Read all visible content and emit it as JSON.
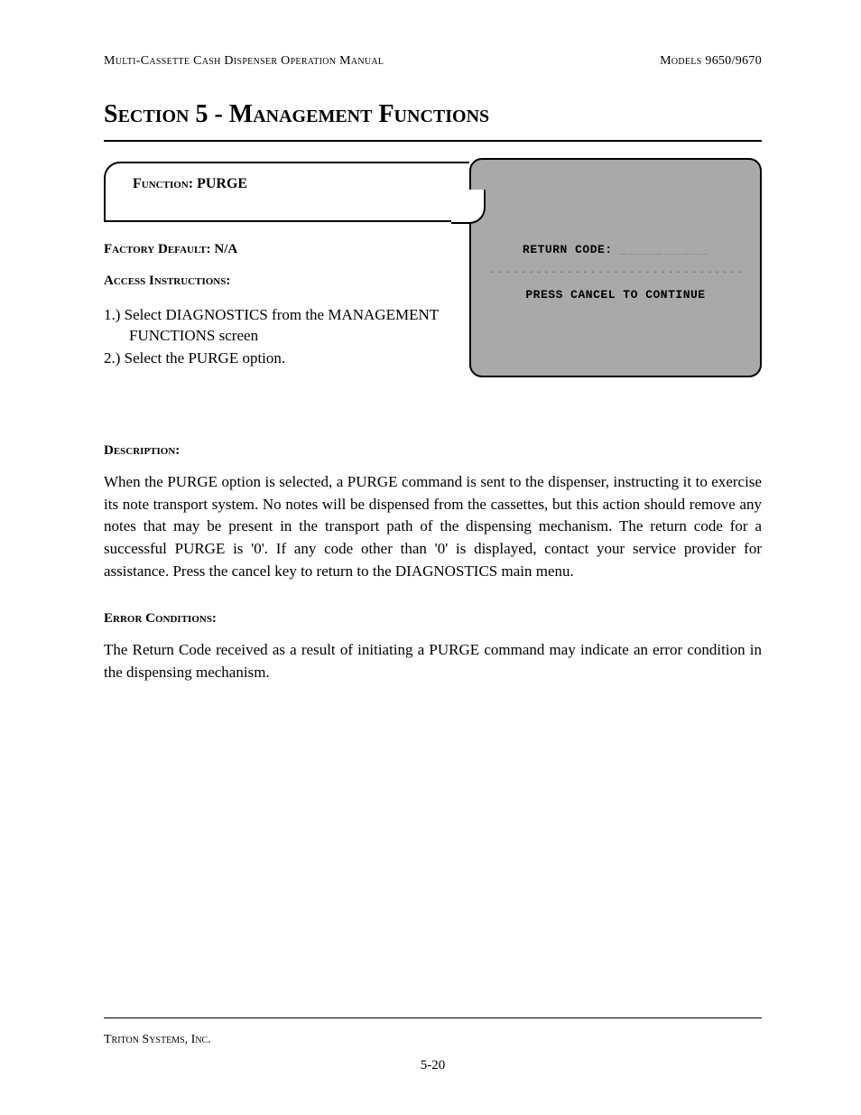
{
  "header": {
    "left": "Multi-Cassette Cash Dispenser Operation Manual",
    "right": "Models 9650/9670"
  },
  "section_title": "Section 5 - Management Functions",
  "function_box": {
    "label_prefix": "Function: ",
    "label_value": "PURGE"
  },
  "screen": {
    "line1_label": "RETURN CODE:",
    "line1_blank": "__________",
    "divider": "----------------------------------------",
    "line2": "PRESS CANCEL TO CONTINUE"
  },
  "factory_default": {
    "label": "Factory Default: ",
    "value": "N/A"
  },
  "access": {
    "label": "Access Instructions:",
    "items": [
      "1.) Select DIAGNOSTICS from the MANAGEMENT FUNCTIONS screen",
      "2.) Select the PURGE option."
    ]
  },
  "description": {
    "label": "Description:",
    "text": "When the PURGE option is selected, a PURGE command is sent to the dispenser, instructing it to exercise its note transport system. No notes will be dispensed from the cassettes, but this action should remove any notes that may be present in the transport path of the dispensing mechanism. The return code for a successful PURGE is '0'.  If any code other than '0' is displayed, contact your service provider for assistance.  Press the cancel key to return to the DIAGNOSTICS main menu."
  },
  "error": {
    "label": "Error Conditions:",
    "text": "The Return Code received as a result of initiating a PURGE command may indicate an error condition in the dispensing mechanism."
  },
  "footer": {
    "company": "Triton Systems, Inc.",
    "page": "5-20"
  }
}
